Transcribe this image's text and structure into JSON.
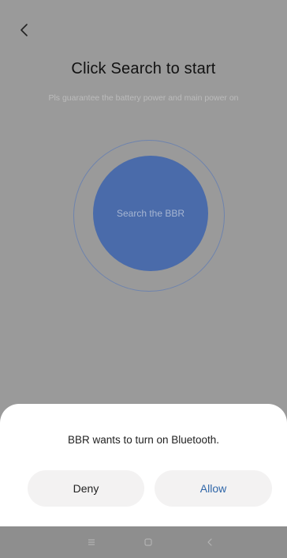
{
  "header": {
    "back_icon": "chevron-left-icon",
    "title": "Click Search to start",
    "subtitle": "Pls guarantee the battery power and main power on"
  },
  "search": {
    "button_label": "Search the BBR",
    "accent_color": "#4a6baa"
  },
  "dialog": {
    "message": "BBR wants to turn on Bluetooth.",
    "deny_label": "Deny",
    "allow_label": "Allow",
    "allow_color": "#2f66a8"
  },
  "navigation_bar": {
    "icons": [
      "recent-apps-icon",
      "home-icon",
      "back-icon"
    ]
  }
}
